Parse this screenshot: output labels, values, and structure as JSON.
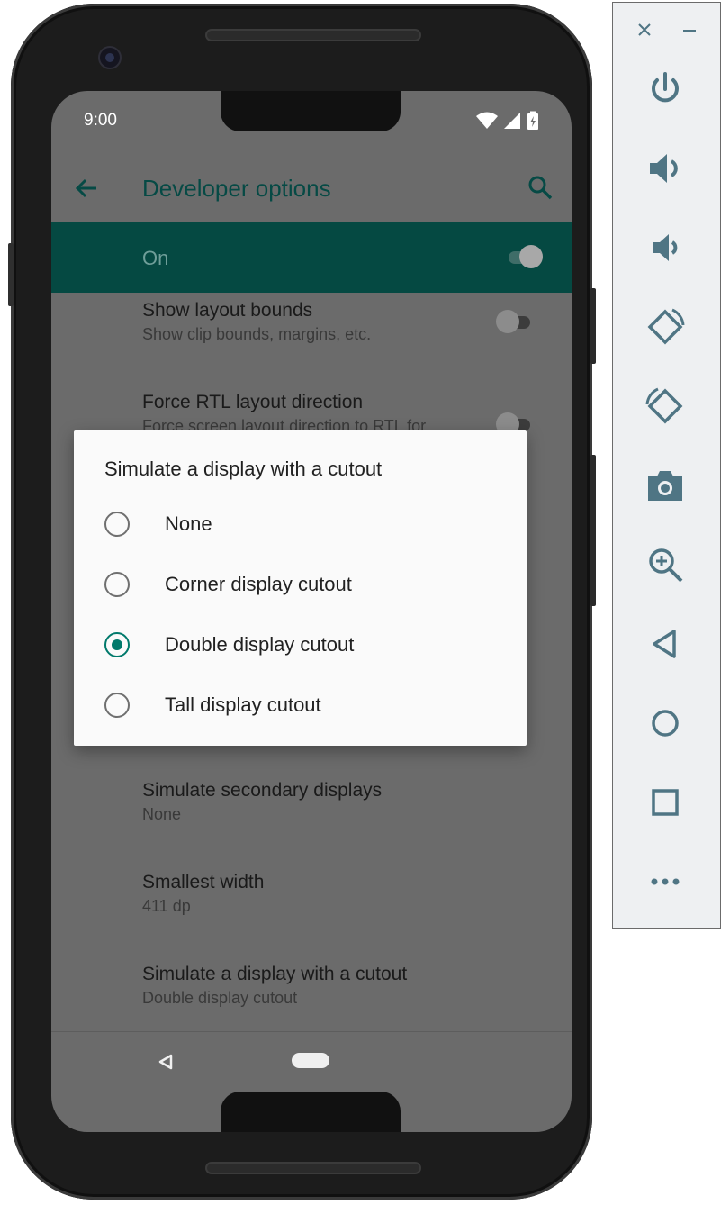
{
  "status_bar": {
    "time": "9:00"
  },
  "app_bar": {
    "title": "Developer options"
  },
  "master_switch": {
    "label": "On",
    "state": "on"
  },
  "settings": [
    {
      "title": "Show layout bounds",
      "subtitle": "Show clip bounds, margins, etc.",
      "toggle": "off"
    },
    {
      "title": "Force RTL layout direction",
      "subtitle": "Force screen layout direction to RTL for",
      "toggle": "off"
    },
    {
      "title": "Simulate secondary displays",
      "subtitle": "None"
    },
    {
      "title": "Smallest width",
      "subtitle": "411 dp"
    },
    {
      "title": "Simulate a display with a cutout",
      "subtitle": "Double display cutout"
    }
  ],
  "dialog": {
    "title": "Simulate a display with a cutout",
    "options": [
      {
        "label": "None",
        "selected": false
      },
      {
        "label": "Corner display cutout",
        "selected": false
      },
      {
        "label": "Double display cutout",
        "selected": true
      },
      {
        "label": "Tall display cutout",
        "selected": false
      }
    ]
  },
  "emulator_toolbar": {
    "window_controls": [
      "close-icon",
      "minimize-icon"
    ],
    "buttons": [
      "power-icon",
      "volume-up-icon",
      "volume-down-icon",
      "rotate-left-icon",
      "rotate-right-icon",
      "camera-icon",
      "zoom-icon",
      "back-icon",
      "home-icon",
      "overview-icon",
      "more-icon"
    ]
  },
  "colors": {
    "accent": "#00796b",
    "appbar_title": "#064a45",
    "master_bar": "#054942",
    "scrim_background": "#6b6b6b",
    "toolbar_icon": "#4f7584"
  }
}
